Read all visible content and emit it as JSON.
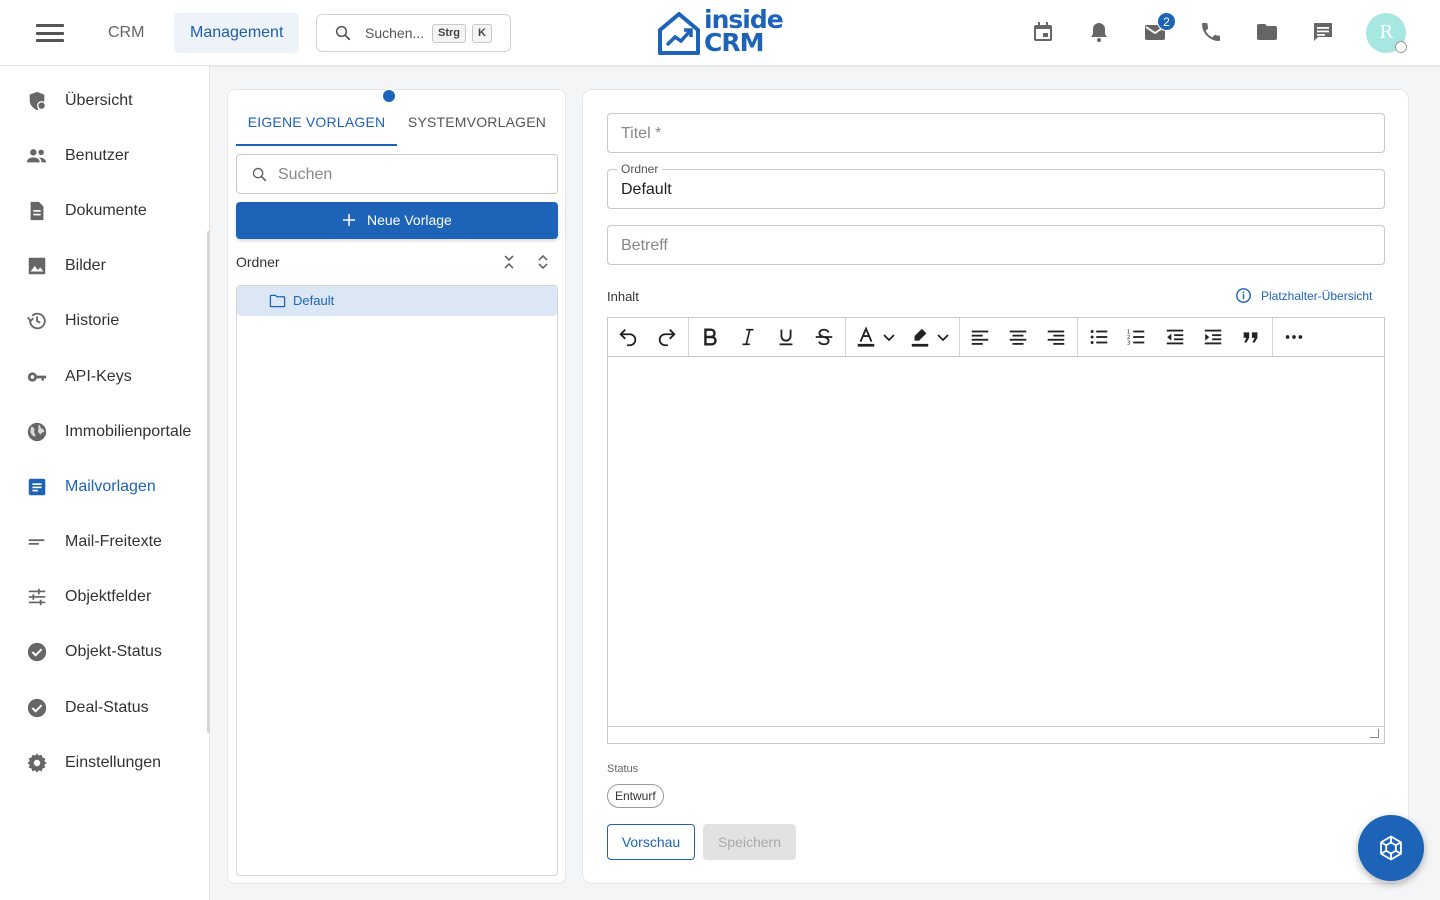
{
  "topbar": {
    "nav": {
      "crm": "CRM",
      "management": "Management"
    },
    "search": {
      "placeholder": "Suchen...",
      "key1": "Strg",
      "key2": "K"
    },
    "logo": {
      "line1": "inside",
      "line2": "CRM"
    },
    "mail_badge": "2",
    "avatar_initial": "R",
    "icons": [
      "calendar-icon",
      "bell-icon",
      "mail-icon",
      "phone-icon",
      "folder-icon",
      "chat-icon"
    ]
  },
  "sidebar": {
    "items": [
      {
        "label": "Übersicht",
        "icon": "dashboard-shield-icon"
      },
      {
        "label": "Benutzer",
        "icon": "users-icon"
      },
      {
        "label": "Dokumente",
        "icon": "document-icon"
      },
      {
        "label": "Bilder",
        "icon": "image-icon"
      },
      {
        "label": "Historie",
        "icon": "history-icon"
      },
      {
        "label": "API-Keys",
        "icon": "key-icon"
      },
      {
        "label": "Immobilienportale",
        "icon": "globe-icon"
      },
      {
        "label": "Mailvorlagen",
        "icon": "mail-template-icon",
        "active": true
      },
      {
        "label": "Mail-Freitexte",
        "icon": "short-text-icon"
      },
      {
        "label": "Objektfelder",
        "icon": "tune-icon"
      },
      {
        "label": "Objekt-Status",
        "icon": "check-circle-icon"
      },
      {
        "label": "Deal-Status",
        "icon": "check-circle-icon"
      },
      {
        "label": "Einstellungen",
        "icon": "gear-icon"
      }
    ]
  },
  "templates_panel": {
    "tabs": {
      "own": "EIGENE VORLAGEN",
      "system": "SYSTEMVORLAGEN"
    },
    "search_placeholder": "Suchen",
    "new_button": "Neue Vorlage",
    "folder_header": "Ordner",
    "folders": [
      {
        "label": "Default",
        "selected": true
      }
    ]
  },
  "editor_form": {
    "title_placeholder": "Titel *",
    "folder_label": "Ordner",
    "folder_value": "Default",
    "subject_placeholder": "Betreff",
    "content_label": "Inhalt",
    "placeholder_link": "Platzhalter-Übersicht",
    "status_label": "Status",
    "status_value": "Entwurf",
    "preview_button": "Vorschau",
    "save_button": "Speichern"
  },
  "colors": {
    "accent": "#1d63b8",
    "selected_bg": "#dbe7f5",
    "avatar": "#a6e7e1"
  }
}
